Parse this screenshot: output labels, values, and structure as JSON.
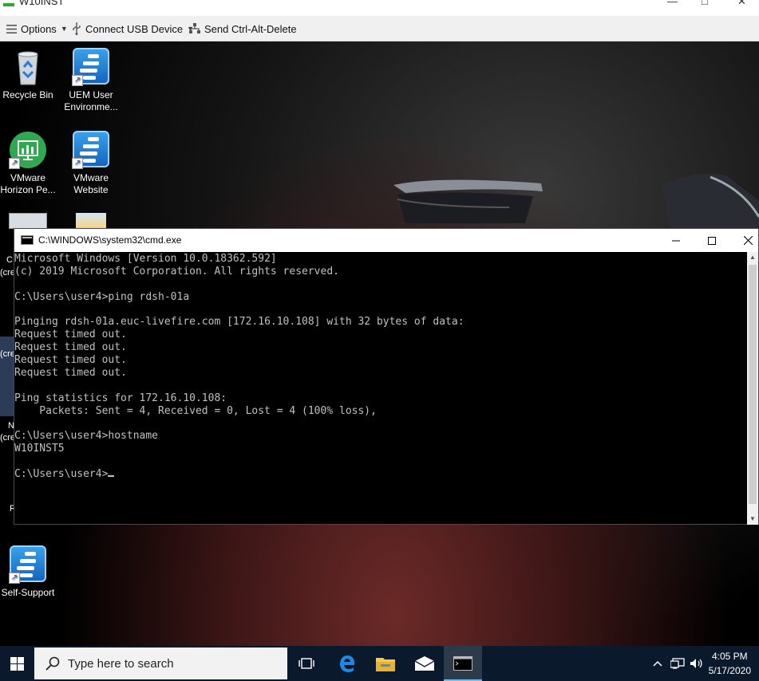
{
  "outer_window": {
    "title": "W10INST",
    "minimize": "—",
    "maximize": "□",
    "close": "✕"
  },
  "toolbar": {
    "options_label": "Options",
    "usb_label": "Connect USB Device",
    "cad_label": "Send Ctrl-Alt-Delete"
  },
  "desktop_icons": {
    "recycle_bin": "Recycle Bin",
    "uem_line1": "UEM User",
    "uem_line2": "Environme...",
    "horizon_line1": "VMware",
    "horizon_line2": "Horizon Pe...",
    "website_line1": "VMware",
    "website_line2": "Website",
    "self_support": "Self-Support",
    "partial_c": "C",
    "partial_cre1": "(cre",
    "partial_cre2": "(cre",
    "partial_n": "N",
    "partial_cre3": "(cre",
    "partial_r": "R"
  },
  "cmd": {
    "title": "C:\\WINDOWS\\system32\\cmd.exe",
    "lines": [
      "Microsoft Windows [Version 10.0.18362.592]",
      "(c) 2019 Microsoft Corporation. All rights reserved.",
      "",
      "C:\\Users\\user4>ping rdsh-01a",
      "",
      "Pinging rdsh-01a.euc-livefire.com [172.16.10.108] with 32 bytes of data:",
      "Request timed out.",
      "Request timed out.",
      "Request timed out.",
      "Request timed out.",
      "",
      "Ping statistics for 172.16.10.108:",
      "    Packets: Sent = 4, Received = 0, Lost = 4 (100% loss),",
      "",
      "C:\\Users\\user4>hostname",
      "W10INST5",
      "",
      "C:\\Users\\user4>"
    ]
  },
  "taskbar": {
    "search_placeholder": "Type here to search",
    "time": "4:05 PM",
    "date": "5/17/2020"
  },
  "colors": {
    "taskbar": "#0a1a2c",
    "console_text": "#c0c0c0",
    "accent": "#76b9ed"
  }
}
